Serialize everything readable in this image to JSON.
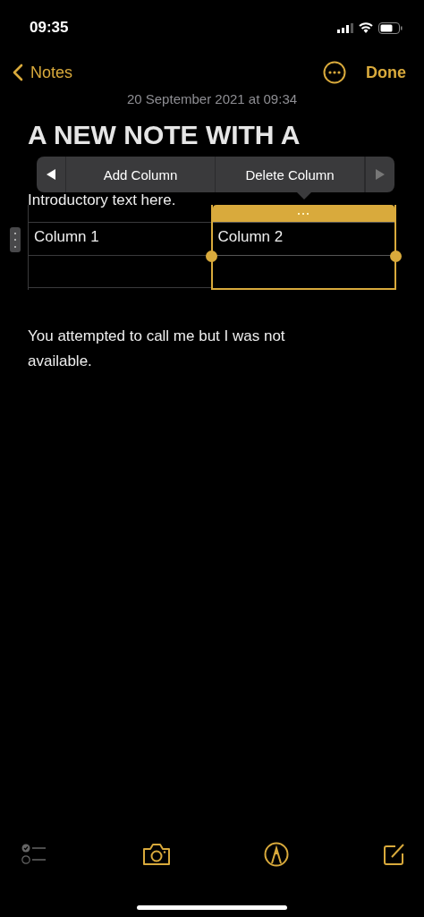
{
  "status_bar": {
    "time": "09:35"
  },
  "nav": {
    "back_label": "Notes",
    "done_label": "Done"
  },
  "date": "20 September 2021 at 09:34",
  "title_lines": [
    "A NEW NOTE WITH A"
  ],
  "context_menu": {
    "prev_disabled": false,
    "next_disabled": true,
    "items": [
      "Add Column",
      "Delete Column"
    ]
  },
  "intro": "Introductory text here.",
  "table": {
    "columns": [
      {
        "header": "Column 1",
        "selected": false
      },
      {
        "header": "Column 2",
        "selected": true
      }
    ]
  },
  "body": "You attempted to call me but I was not available."
}
